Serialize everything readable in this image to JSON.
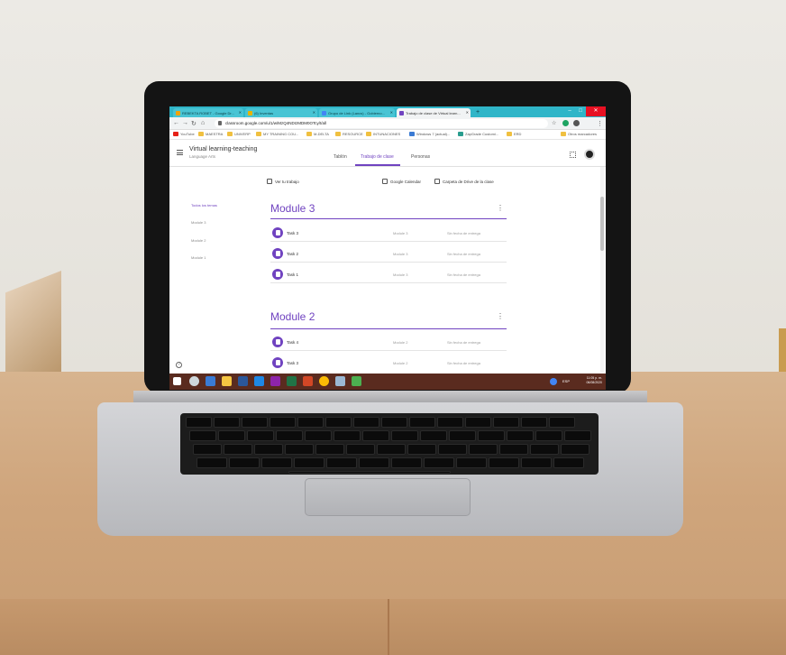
{
  "browser": {
    "tabs": [
      {
        "label": "REBEKTA ROBET - Google Dr..."
      },
      {
        "label": "(6) Inventas"
      },
      {
        "label": "Grupo de Link (Lancs) - Gobierno..."
      },
      {
        "label": "Trabajo de clase de Virtual learn..."
      }
    ],
    "url": "classroom.google.com/u/1/w/MzQ4NDIzMDM0OTcy/t/all",
    "bookmarks": [
      "YouTube",
      "MAESTRA",
      "UNIVERP",
      "MY TRAINING COU...",
      "M-DELTA",
      "RESOURCE",
      "INTUNACIONES",
      "Windows 7 (actual)...",
      "ZapGrade Customi...",
      "ERD",
      "Otros marcadores"
    ]
  },
  "classroom": {
    "title": "Virtual learning-teaching",
    "subtitle": "Language Arts",
    "tabs": [
      "Tablón",
      "Trabajo de clase",
      "Personas"
    ],
    "view_work": "Ver tu trabajo",
    "calendar_link": "Google Calendar",
    "drive_link": "Carpeta de Drive de la clase",
    "sidebar": [
      "Todos los temas",
      "Module 3",
      "Module 2",
      "Module 1"
    ],
    "modules": [
      {
        "title": "Module 3",
        "tasks": [
          {
            "name": "Task 3",
            "module": "Module 3",
            "due": "Sin fecha de entrega"
          },
          {
            "name": "Task 2",
            "module": "Module 3",
            "due": "Sin fecha de entrega"
          },
          {
            "name": "Task 1",
            "module": "Module 3",
            "due": "Sin fecha de entrega"
          }
        ]
      },
      {
        "title": "Module 2",
        "tasks": [
          {
            "name": "Task 4",
            "module": "Module 2",
            "due": "Sin fecha de entrega"
          },
          {
            "name": "Task 3",
            "module": "Module 2",
            "due": "Sin fecha de entrega"
          }
        ]
      }
    ]
  },
  "taskbar": {
    "time": "11:05 p. m.",
    "date": "06/08/2020",
    "lang": "ESP"
  },
  "colors": {
    "accent": "#7043c0",
    "tabbar": "#2fb5c8",
    "taskbar": "#5a2b1f"
  }
}
